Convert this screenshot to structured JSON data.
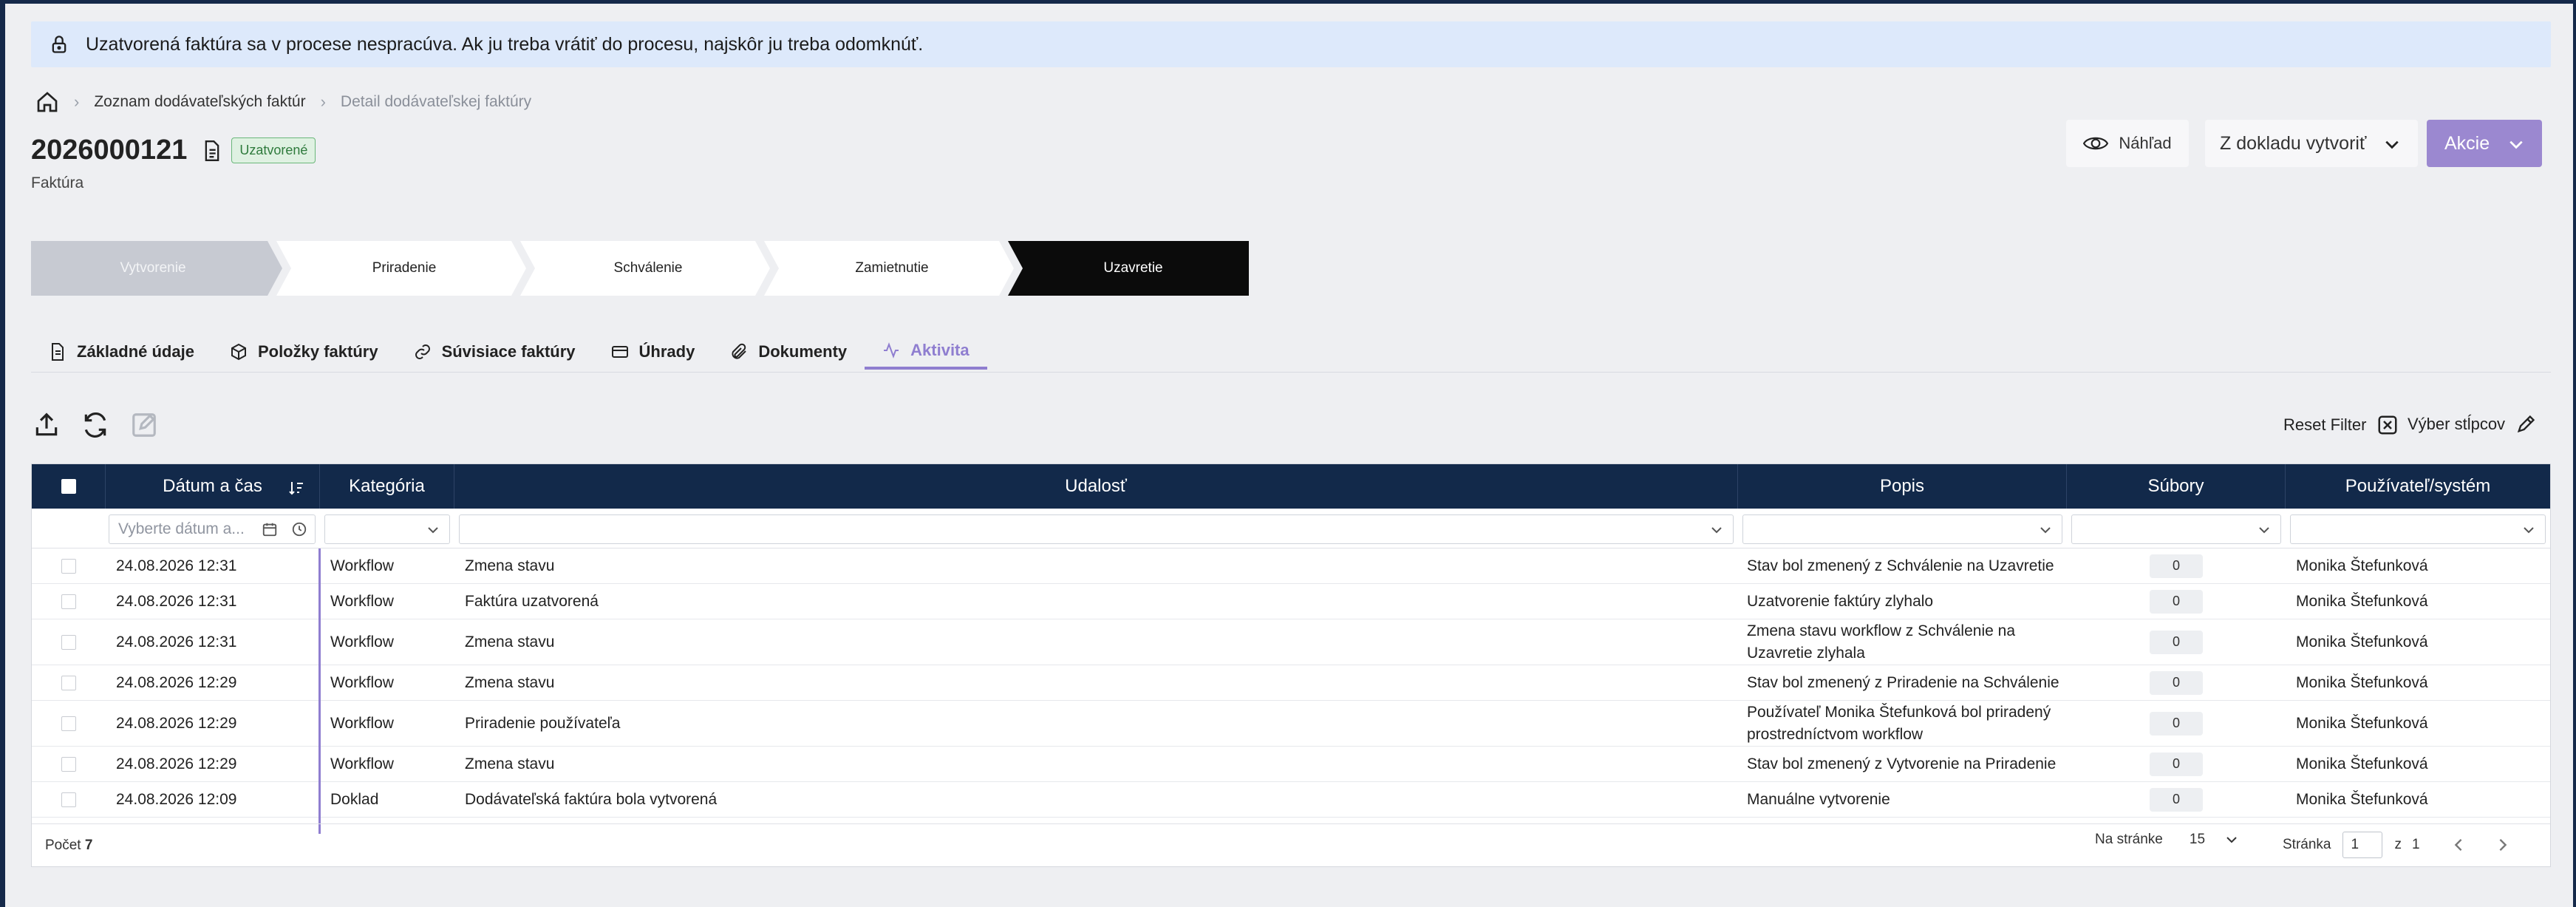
{
  "banner": {
    "text": "Uzatvorená faktúra sa v procese nespracúva. Ak ju treba vrátiť do procesu, najskôr ju treba odomknúť."
  },
  "breadcrumb": {
    "items": [
      "Zoznam dodávateľských faktúr",
      "Detail dodávateľskej faktúry"
    ]
  },
  "header": {
    "title": "2026000121",
    "status": "Uzatvorené",
    "subtitle": "Faktúra",
    "preview_label": "Náhľad",
    "create_label": "Z dokladu vytvoriť",
    "actions_label": "Akcie"
  },
  "stepper": {
    "steps": [
      "Vytvorenie",
      "Priradenie",
      "Schválenie",
      "Zamietnutie",
      "Uzavretie"
    ],
    "completed_index": 0,
    "current_index": 4
  },
  "tabs": [
    "Základné údaje",
    "Položky faktúry",
    "Súvisiace faktúry",
    "Úhrady",
    "Dokumenty",
    "Aktivita"
  ],
  "active_tab": "Aktivita",
  "toolbar": {
    "reset_filter": "Reset Filter",
    "column_select": "Výber stĺpcov"
  },
  "table": {
    "columns": [
      "Dátum a čas",
      "Kategória",
      "Udalosť",
      "Popis",
      "Súbory",
      "Používateľ/systém"
    ],
    "date_filter_placeholder": "Vyberte dátum a...",
    "rows": [
      {
        "datetime": "24.08.2026 12:31",
        "category": "Workflow",
        "event": "Zmena stavu",
        "desc1": "Stav bol zmenený z Schválenie na Uzavretie",
        "desc2": "",
        "files": "0",
        "user": "Monika Štefunková"
      },
      {
        "datetime": "24.08.2026 12:31",
        "category": "Workflow",
        "event": "Faktúra uzatvorená",
        "desc1": "Uzatvorenie faktúry zlyhalo",
        "desc2": "",
        "files": "0",
        "user": "Monika Štefunková"
      },
      {
        "datetime": "24.08.2026 12:31",
        "category": "Workflow",
        "event": "Zmena stavu",
        "desc1": "Zmena stavu workflow z Schválenie na",
        "desc2": "Uzavretie zlyhala",
        "files": "0",
        "user": "Monika Štefunková"
      },
      {
        "datetime": "24.08.2026 12:29",
        "category": "Workflow",
        "event": "Zmena stavu",
        "desc1": "Stav bol zmenený z Priradenie na Schválenie",
        "desc2": "",
        "files": "0",
        "user": "Monika Štefunková"
      },
      {
        "datetime": "24.08.2026 12:29",
        "category": "Workflow",
        "event": "Priradenie používateľa",
        "desc1": "Používateľ Monika Štefunková bol priradený",
        "desc2": "prostredníctvom workflow",
        "files": "0",
        "user": "Monika Štefunková"
      },
      {
        "datetime": "24.08.2026 12:29",
        "category": "Workflow",
        "event": "Zmena stavu",
        "desc1": "Stav bol zmenený z Vytvorenie na Priradenie",
        "desc2": "",
        "files": "0",
        "user": "Monika Štefunková"
      },
      {
        "datetime": "24.08.2026 12:09",
        "category": "Doklad",
        "event": "Dodávateľská faktúra bola vytvorená",
        "desc1": "Manuálne vytvorenie",
        "desc2": "",
        "files": "0",
        "user": "Monika Štefunková"
      }
    ]
  },
  "footer": {
    "count_label": "Počet",
    "count_value": "7",
    "per_page_label": "Na stránke",
    "per_page_value": "15",
    "page_label": "Stránka",
    "page_value": "1",
    "of_label": "z",
    "total_pages": "1"
  },
  "colors": {
    "accent": "#9b88d0",
    "header_bg": "#12294a",
    "banner_bg": "#dde9fb"
  }
}
